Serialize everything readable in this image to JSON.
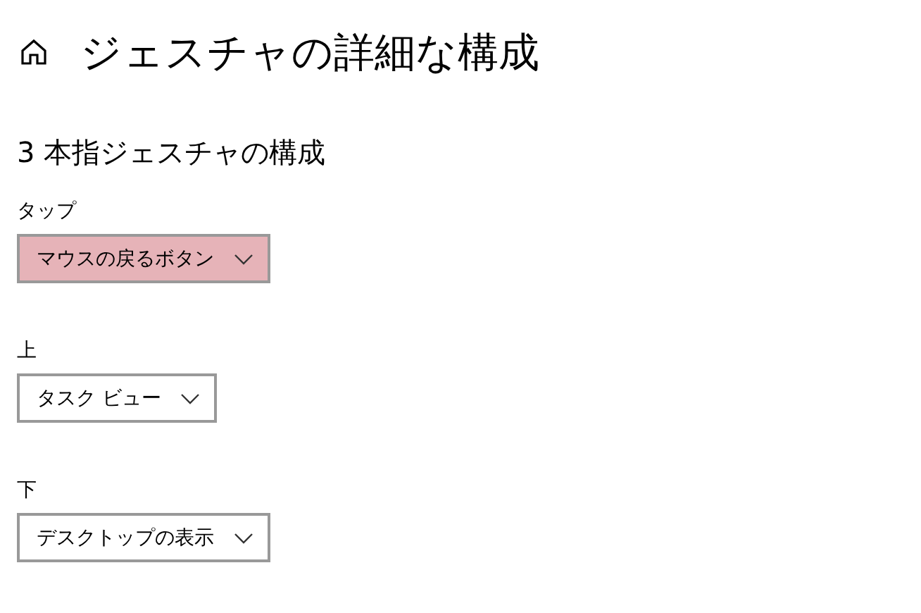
{
  "header": {
    "title": "ジェスチャの詳細な構成"
  },
  "section": {
    "heading": "3 本指ジェスチャの構成"
  },
  "settings": [
    {
      "label": "タップ",
      "value": "マウスの戻るボタン",
      "highlighted": true
    },
    {
      "label": "上",
      "value": "タスク ビュー",
      "highlighted": false
    },
    {
      "label": "下",
      "value": "デスクトップの表示",
      "highlighted": false
    }
  ]
}
